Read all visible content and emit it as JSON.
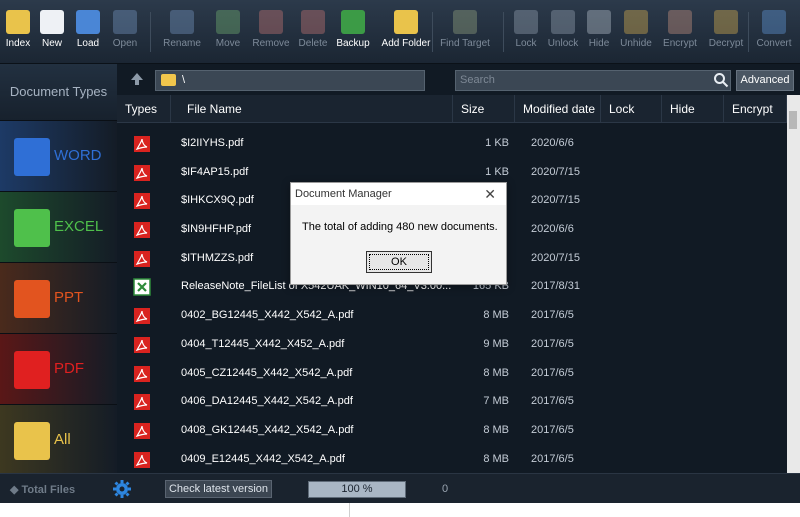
{
  "toolbar": [
    {
      "label": "Index",
      "icon": "index-icon",
      "enabled": true,
      "color": "#e9c34b"
    },
    {
      "label": "New",
      "icon": "new-document-icon",
      "enabled": true,
      "color": "#eef1f5"
    },
    {
      "label": "Load",
      "icon": "load-icon",
      "enabled": true,
      "color": "#4a86d6"
    },
    {
      "label": "Open",
      "icon": "open-icon",
      "enabled": false,
      "color": "#6d8bb3"
    },
    {
      "label": "Rename",
      "icon": "rename-icon",
      "enabled": false,
      "color": "#6d8bb3"
    },
    {
      "label": "Move",
      "icon": "move-icon",
      "enabled": false,
      "color": "#6aa36c"
    },
    {
      "label": "Remove",
      "icon": "remove-icon",
      "enabled": false,
      "color": "#b56f6f"
    },
    {
      "label": "Delete",
      "icon": "delete-icon",
      "enabled": false,
      "color": "#b56f6f"
    },
    {
      "label": "Backup",
      "icon": "backup-icon",
      "enabled": true,
      "color": "#3c9b46"
    },
    {
      "label": "Add Folder",
      "icon": "add-folder-icon",
      "enabled": true,
      "color": "#e9c34b"
    },
    {
      "label": "Find Target",
      "icon": "find-target-icon",
      "enabled": false,
      "color": "#8a9a7a"
    },
    {
      "label": "Lock",
      "icon": "lock-icon",
      "enabled": false,
      "color": "#8a97a6"
    },
    {
      "label": "Unlock",
      "icon": "unlock-icon",
      "enabled": false,
      "color": "#8a97a6"
    },
    {
      "label": "Hide",
      "icon": "hide-icon",
      "enabled": false,
      "color": "#a9b3bf"
    },
    {
      "label": "Unhide",
      "icon": "unhide-icon",
      "enabled": false,
      "color": "#c7a54d"
    },
    {
      "label": "Encrypt",
      "icon": "encrypt-icon",
      "enabled": false,
      "color": "#b88a7a"
    },
    {
      "label": "Decrypt",
      "icon": "decrypt-icon",
      "enabled": false,
      "color": "#c7a54d"
    },
    {
      "label": "Convert",
      "icon": "convert-icon",
      "enabled": false,
      "color": "#5b8fc9"
    }
  ],
  "sidebar": {
    "title": "Document Types",
    "categories": [
      {
        "label": "WORD",
        "icon": "word-icon",
        "color": "#2f6fd6",
        "bg": "#1d3a66"
      },
      {
        "label": "EXCEL",
        "icon": "excel-icon",
        "color": "#4fc04b",
        "bg": "#1d4a2c"
      },
      {
        "label": "PPT",
        "icon": "ppt-icon",
        "color": "#e2541f",
        "bg": "#4a2a1c"
      },
      {
        "label": "PDF",
        "icon": "pdf-icon",
        "color": "#e02020",
        "bg": "#5a1717"
      },
      {
        "label": "All",
        "icon": "folder-icon",
        "color": "#e9c34b",
        "bg": "#3d3820"
      }
    ]
  },
  "pathbar": {
    "path": "\\",
    "search_placeholder": "Search",
    "advanced_label": "Advanced"
  },
  "table": {
    "columns": [
      "Types",
      "File Name",
      "Size",
      "Modified date",
      "Lock",
      "Hide",
      "Encrypt"
    ],
    "rows": [
      {
        "type": "pdf",
        "name": "$I2IIYHS.pdf",
        "size": "1 KB",
        "date": "2020/6/6"
      },
      {
        "type": "pdf",
        "name": "$IF4AP15.pdf",
        "size": "1 KB",
        "date": "2020/7/15"
      },
      {
        "type": "pdf",
        "name": "$IHKCX9Q.pdf",
        "size": "",
        "date": "2020/7/15"
      },
      {
        "type": "pdf",
        "name": "$IN9HFHP.pdf",
        "size": "",
        "date": "2020/6/6"
      },
      {
        "type": "pdf",
        "name": "$ITHMZZS.pdf",
        "size": "",
        "date": "2020/7/15"
      },
      {
        "type": "excel",
        "name": "ReleaseNote_FileList of X542UAK_WIN10_64_V3.00...",
        "size": "165 KB",
        "date": "2017/8/31"
      },
      {
        "type": "pdf",
        "name": "0402_BG12445_X442_X542_A.pdf",
        "size": "8 MB",
        "date": "2017/6/5"
      },
      {
        "type": "pdf",
        "name": "0404_T12445_X442_X452_A.pdf",
        "size": "9 MB",
        "date": "2017/6/5"
      },
      {
        "type": "pdf",
        "name": "0405_CZ12445_X442_X542_A.pdf",
        "size": "8 MB",
        "date": "2017/6/5"
      },
      {
        "type": "pdf",
        "name": "0406_DA12445_X442_X542_A.pdf",
        "size": "7 MB",
        "date": "2017/6/5"
      },
      {
        "type": "pdf",
        "name": "0408_GK12445_X442_X542_A.pdf",
        "size": "8 MB",
        "date": "2017/6/5"
      },
      {
        "type": "pdf",
        "name": "0409_E12445_X442_X542_A.pdf",
        "size": "8 MB",
        "date": "2017/6/5"
      }
    ]
  },
  "statusbar": {
    "total_files_label": "Total Files",
    "check_version_label": "Check latest version",
    "progress_text": "100 %",
    "progress_value": 1.0,
    "count": "0"
  },
  "dialog": {
    "title": "Document Manager",
    "message": "The total of adding 480 new documents.",
    "ok_label": "OK",
    "close_glyph": "✕"
  }
}
